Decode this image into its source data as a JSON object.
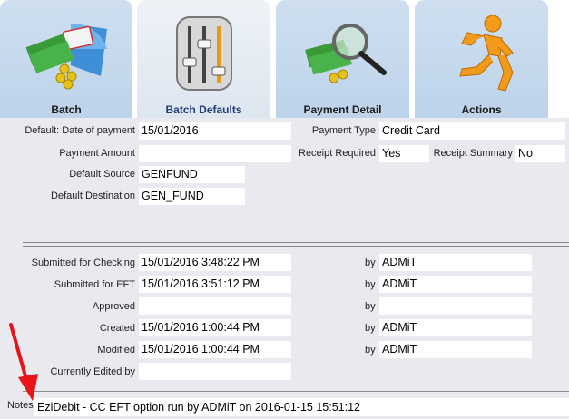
{
  "tabs": [
    {
      "label": "Batch",
      "icon": "batch-money-card-icon"
    },
    {
      "label": "Batch Defaults",
      "icon": "sliders-icon"
    },
    {
      "label": "Payment Detail",
      "icon": "money-magnifier-icon"
    },
    {
      "label": "Actions",
      "icon": "running-man-icon"
    }
  ],
  "defaults": {
    "date_label": "Default: Date of payment",
    "date_value": "15/01/2016",
    "amount_label": "Payment Amount",
    "amount_value": "",
    "source_label": "Default Source",
    "source_value": "GENFUND",
    "dest_label": "Default Destination",
    "dest_value": "GEN_FUND",
    "type_label": "Payment Type",
    "type_value": "Credit Card",
    "receipt_req_label": "Receipt Required",
    "receipt_req_value": "Yes",
    "receipt_sum_label": "Receipt Summary",
    "receipt_sum_value": "No"
  },
  "audit": {
    "by_label": "by",
    "rows": [
      {
        "label": "Submitted for Checking",
        "value": "15/01/2016 3:48:22 PM",
        "by": "ADMiT"
      },
      {
        "label": "Submitted for EFT",
        "value": "15/01/2016 3:51:12 PM",
        "by": "ADMiT"
      },
      {
        "label": "Approved",
        "value": "",
        "by": ""
      },
      {
        "label": "Created",
        "value": "15/01/2016 1:00:44 PM",
        "by": "ADMiT"
      },
      {
        "label": "Modified",
        "value": "15/01/2016 1:00:44 PM",
        "by": "ADMiT"
      }
    ],
    "edited_label": "Currently Edited by",
    "edited_value": ""
  },
  "notes": {
    "label": "Notes",
    "value": "EziDebit - CC EFT option run by ADMiT on 2016-01-15 15:51:12"
  },
  "colors": {
    "tab_bg": "#c5d8ec",
    "tab_active_bg": "#e6ecf3",
    "content_bg": "#e8eaef",
    "arrow": "#e8141a",
    "active_label": "#1f3d78"
  }
}
